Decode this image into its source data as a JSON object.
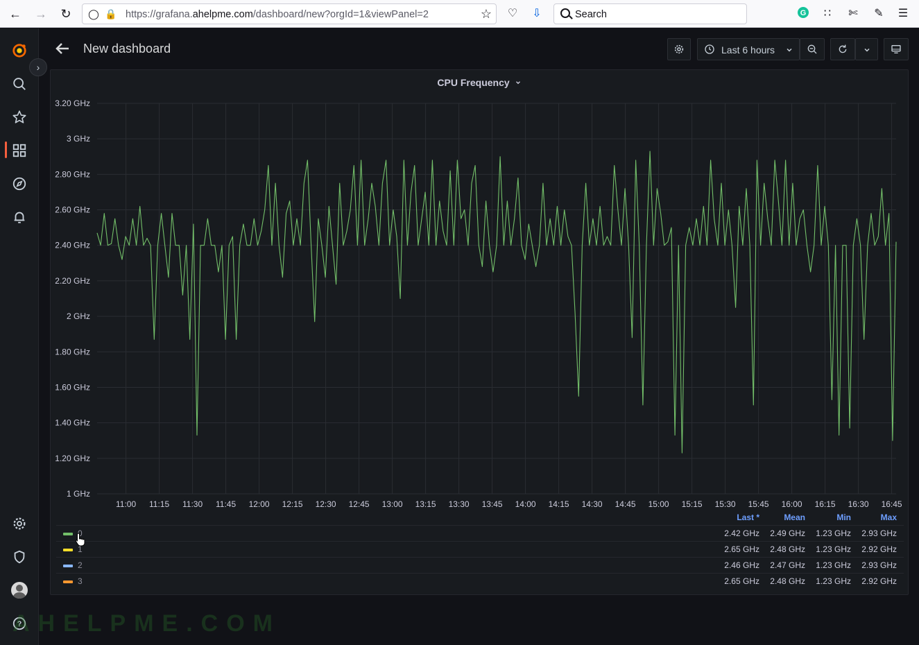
{
  "browser": {
    "url_prefix": "https://grafana.",
    "url_domain": "ahelpme.com",
    "url_path": "/dashboard/new?orgId=1&viewPanel=2",
    "search_placeholder": "Search"
  },
  "dashboard": {
    "title": "New dashboard",
    "time_range_label": "Last 6 hours"
  },
  "panel": {
    "title": "CPU Frequency",
    "legend_headers": {
      "last": "Last *",
      "mean": "Mean",
      "min": "Min",
      "max": "Max"
    },
    "legend": [
      {
        "name": "0",
        "color": "#73bf69",
        "last": "2.42 GHz",
        "mean": "2.49 GHz",
        "min": "1.23 GHz",
        "max": "2.93 GHz"
      },
      {
        "name": "1",
        "color": "#fade2a",
        "last": "2.65 GHz",
        "mean": "2.48 GHz",
        "min": "1.23 GHz",
        "max": "2.92 GHz"
      },
      {
        "name": "2",
        "color": "#8ab8ff",
        "last": "2.46 GHz",
        "mean": "2.47 GHz",
        "min": "1.23 GHz",
        "max": "2.93 GHz"
      },
      {
        "name": "3",
        "color": "#ff9830",
        "last": "2.65 GHz",
        "mean": "2.48 GHz",
        "min": "1.23 GHz",
        "max": "2.92 GHz"
      }
    ]
  },
  "chart_data": {
    "type": "line",
    "title": "CPU Frequency",
    "x_ticks": [
      "11:00",
      "11:15",
      "11:30",
      "11:45",
      "12:00",
      "12:15",
      "12:30",
      "12:45",
      "13:00",
      "13:15",
      "13:30",
      "13:45",
      "14:00",
      "14:15",
      "14:30",
      "14:45",
      "15:00",
      "15:15",
      "15:30",
      "15:45",
      "16:00",
      "16:15",
      "16:30",
      "16:45"
    ],
    "y_ticks": [
      "1 GHz",
      "1.20 GHz",
      "1.40 GHz",
      "1.60 GHz",
      "1.80 GHz",
      "2 GHz",
      "2.20 GHz",
      "2.40 GHz",
      "2.60 GHz",
      "2.80 GHz",
      "3 GHz",
      "3.20 GHz"
    ],
    "ylim": [
      1.0,
      3.2
    ],
    "grid": true,
    "legend_placement": "bottom",
    "series": [
      {
        "name": "0",
        "color": "#73bf69",
        "x_start": "10:47",
        "x_end": "16:47",
        "values": [
          2.47,
          2.4,
          2.58,
          2.4,
          2.41,
          2.55,
          2.4,
          2.32,
          2.45,
          2.4,
          2.55,
          2.4,
          2.62,
          2.4,
          2.44,
          2.4,
          1.87,
          2.4,
          2.58,
          2.4,
          2.22,
          2.58,
          2.4,
          2.4,
          2.12,
          2.4,
          1.87,
          2.52,
          1.33,
          2.4,
          2.4,
          2.55,
          2.4,
          2.4,
          2.25,
          2.4,
          1.87,
          2.4,
          2.45,
          1.87,
          2.4,
          2.52,
          2.4,
          2.4,
          2.55,
          2.4,
          2.48,
          2.6,
          2.85,
          2.4,
          2.75,
          2.4,
          2.22,
          2.58,
          2.65,
          2.4,
          2.55,
          2.4,
          2.75,
          2.88,
          2.4,
          1.97,
          2.55,
          2.4,
          2.22,
          2.62,
          2.4,
          2.18,
          2.75,
          2.4,
          2.48,
          2.6,
          2.85,
          2.4,
          2.88,
          2.4,
          2.55,
          2.75,
          2.62,
          2.4,
          2.75,
          2.88,
          2.4,
          2.6,
          2.45,
          2.1,
          2.88,
          2.4,
          2.7,
          2.85,
          2.4,
          2.55,
          2.7,
          2.4,
          2.88,
          2.4,
          2.65,
          2.48,
          2.4,
          2.82,
          2.4,
          2.88,
          2.55,
          2.6,
          2.4,
          2.75,
          2.85,
          2.4,
          2.28,
          2.65,
          2.4,
          2.25,
          2.4,
          2.9,
          2.4,
          2.65,
          2.4,
          2.55,
          2.78,
          2.4,
          2.32,
          2.52,
          2.4,
          2.28,
          2.4,
          2.75,
          2.4,
          2.55,
          2.4,
          2.62,
          2.4,
          2.6,
          2.45,
          2.4,
          2.02,
          1.55,
          2.4,
          2.75,
          2.4,
          2.55,
          2.4,
          2.62,
          2.4,
          2.45,
          2.4,
          2.85,
          2.6,
          2.4,
          2.72,
          2.4,
          1.88,
          2.88,
          2.4,
          1.5,
          2.4,
          2.93,
          2.4,
          2.72,
          2.58,
          2.4,
          2.42,
          2.5,
          1.33,
          2.4,
          1.23,
          2.4,
          2.5,
          2.4,
          2.55,
          2.4,
          2.62,
          2.4,
          2.88,
          2.55,
          2.4,
          2.75,
          2.4,
          2.6,
          2.4,
          2.05,
          2.62,
          2.4,
          2.72,
          2.4,
          1.5,
          2.88,
          2.4,
          2.75,
          2.55,
          2.4,
          2.88,
          2.65,
          2.4,
          2.88,
          2.4,
          2.75,
          2.4,
          2.55,
          2.6,
          2.4,
          2.25,
          2.4,
          2.85,
          2.4,
          2.62,
          2.4,
          1.53,
          2.4,
          1.33,
          2.4,
          2.4,
          1.37,
          2.4,
          2.55,
          2.4,
          1.87,
          2.4,
          2.58,
          2.4,
          2.45,
          2.72,
          2.4,
          2.58,
          1.3,
          2.42
        ]
      }
    ]
  },
  "watermark": "AHELPME.COM",
  "colors": {
    "accent": "#f55f3e",
    "legend_header": "#6e9fff",
    "panel_bg": "#181b1f",
    "page_bg": "#111217"
  }
}
